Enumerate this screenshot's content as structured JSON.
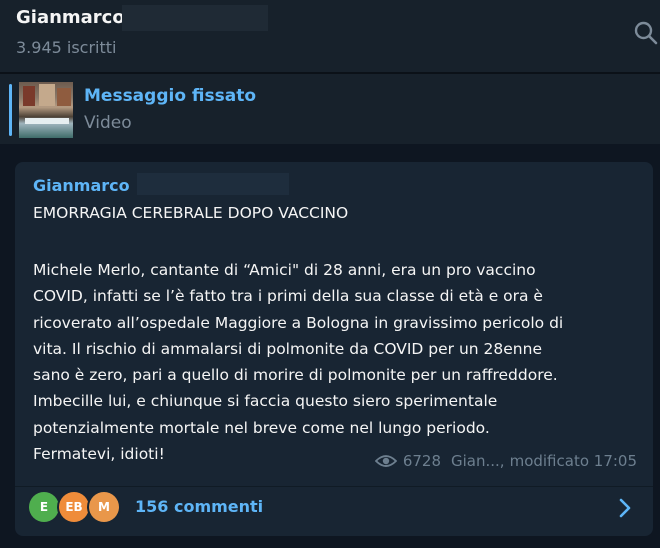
{
  "header": {
    "channel_name": "Gianmarco",
    "subscribers": "3.945 iscritti",
    "search_icon": "search-icon"
  },
  "pinned": {
    "title": "Messaggio fissato",
    "subtitle": "Video"
  },
  "post": {
    "author": "Gianmarco",
    "headline": "EMORRAGIA CEREBRALE DOPO VACCINO",
    "body_lines": [
      "Michele Merlo, cantante di “Amici\" di 28 anni, era  un pro vaccino",
      "COVID, infatti se l’è fatto tra i primi della sua classe di età e ora è",
      "ricoverato all’ospedale Maggiore a Bologna in gravissimo pericolo di",
      "vita. Il rischio di ammalarsi di polmonite da COVID per un 28enne",
      "sano è zero, pari a quello di morire di polmonite per un raffreddore.",
      "Imbecille lui, e chiunque si faccia questo siero sperimentale",
      "potenzialmente mortale nel breve come nel lungo periodo.",
      "Fermatevi, idioti!"
    ],
    "views": "6728",
    "signature": "Gian...,",
    "edited": "modificato 17:05"
  },
  "comments": {
    "avatars": [
      {
        "initials": "E",
        "color": "#4fae4e"
      },
      {
        "initials": "EB",
        "color": "#ef8c3a"
      },
      {
        "initials": "M",
        "color": "#e9974a"
      }
    ],
    "label": "156 commenti"
  },
  "colors": {
    "accent": "#5eb5f7",
    "background": "#0e1621",
    "panel": "#17212b",
    "bubble": "#182533",
    "muted": "#7d8b99"
  }
}
